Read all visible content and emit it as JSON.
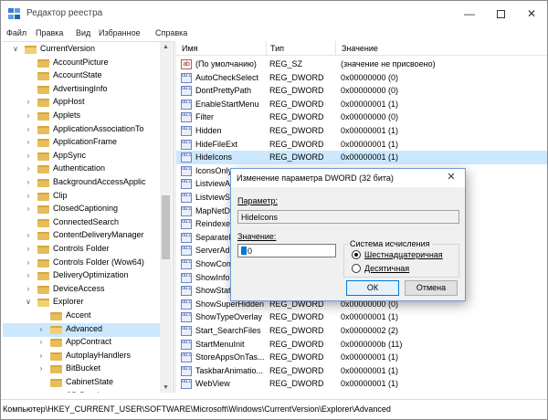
{
  "window": {
    "title": "Редактор реестра"
  },
  "menu": [
    "Файл",
    "Правка",
    "Вид",
    "Избранное",
    "Справка"
  ],
  "tree": [
    {
      "label": "CurrentVersion",
      "depth": 0,
      "chevron": "open",
      "open": true
    },
    {
      "label": "AccountPicture",
      "depth": 1,
      "chevron": "none"
    },
    {
      "label": "AccountState",
      "depth": 1,
      "chevron": "none"
    },
    {
      "label": "AdvertisingInfo",
      "depth": 1,
      "chevron": "none"
    },
    {
      "label": "AppHost",
      "depth": 1,
      "chevron": "closed"
    },
    {
      "label": "Applets",
      "depth": 1,
      "chevron": "closed"
    },
    {
      "label": "ApplicationAssociationTo",
      "depth": 1,
      "chevron": "closed"
    },
    {
      "label": "ApplicationFrame",
      "depth": 1,
      "chevron": "closed"
    },
    {
      "label": "AppSync",
      "depth": 1,
      "chevron": "closed"
    },
    {
      "label": "Authentication",
      "depth": 1,
      "chevron": "closed"
    },
    {
      "label": "BackgroundAccessApplic",
      "depth": 1,
      "chevron": "closed"
    },
    {
      "label": "Clip",
      "depth": 1,
      "chevron": "closed"
    },
    {
      "label": "ClosedCaptioning",
      "depth": 1,
      "chevron": "closed"
    },
    {
      "label": "ConnectedSearch",
      "depth": 1,
      "chevron": "none"
    },
    {
      "label": "ContentDeliveryManager",
      "depth": 1,
      "chevron": "closed"
    },
    {
      "label": "Controls Folder",
      "depth": 1,
      "chevron": "closed"
    },
    {
      "label": "Controls Folder (Wow64)",
      "depth": 1,
      "chevron": "closed"
    },
    {
      "label": "DeliveryOptimization",
      "depth": 1,
      "chevron": "closed"
    },
    {
      "label": "DeviceAccess",
      "depth": 1,
      "chevron": "closed"
    },
    {
      "label": "Explorer",
      "depth": 1,
      "chevron": "open",
      "open": true
    },
    {
      "label": "Accent",
      "depth": 2,
      "chevron": "none"
    },
    {
      "label": "Advanced",
      "depth": 2,
      "chevron": "closed",
      "selected": true
    },
    {
      "label": "AppContract",
      "depth": 2,
      "chevron": "closed"
    },
    {
      "label": "AutoplayHandlers",
      "depth": 2,
      "chevron": "closed"
    },
    {
      "label": "BitBucket",
      "depth": 2,
      "chevron": "closed"
    },
    {
      "label": "CabinetState",
      "depth": 2,
      "chevron": "none"
    },
    {
      "label": "CD Burning",
      "depth": 2,
      "chevron": "closed"
    }
  ],
  "columns": {
    "name": "Имя",
    "type": "Тип",
    "data": "Значение"
  },
  "values": [
    {
      "icon": "ab",
      "name": "(По умолчанию)",
      "type": "REG_SZ",
      "data": "(значение не присвоено)"
    },
    {
      "icon": "dw",
      "name": "AutoCheckSelect",
      "type": "REG_DWORD",
      "data": "0x00000000 (0)"
    },
    {
      "icon": "dw",
      "name": "DontPrettyPath",
      "type": "REG_DWORD",
      "data": "0x00000000 (0)"
    },
    {
      "icon": "dw",
      "name": "EnableStartMenu",
      "type": "REG_DWORD",
      "data": "0x00000001 (1)"
    },
    {
      "icon": "dw",
      "name": "Filter",
      "type": "REG_DWORD",
      "data": "0x00000000 (0)"
    },
    {
      "icon": "dw",
      "name": "Hidden",
      "type": "REG_DWORD",
      "data": "0x00000001 (1)"
    },
    {
      "icon": "dw",
      "name": "HideFileExt",
      "type": "REG_DWORD",
      "data": "0x00000001 (1)"
    },
    {
      "icon": "dw",
      "name": "HideIcons",
      "type": "REG_DWORD",
      "data": "0x00000001 (1)",
      "selected": true
    },
    {
      "icon": "dw",
      "name": "IconsOnly",
      "type": "",
      "data": ""
    },
    {
      "icon": "dw",
      "name": "ListviewAl",
      "type": "",
      "data": ""
    },
    {
      "icon": "dw",
      "name": "ListviewSh",
      "type": "",
      "data": ""
    },
    {
      "icon": "dw",
      "name": "MapNetDr",
      "type": "",
      "data": ""
    },
    {
      "icon": "dw",
      "name": "Reindexed",
      "type": "",
      "data": ""
    },
    {
      "icon": "dw",
      "name": "SeparatePr",
      "type": "",
      "data": ""
    },
    {
      "icon": "dw",
      "name": "ServerAdm",
      "type": "",
      "data": ""
    },
    {
      "icon": "dw",
      "name": "ShowCom",
      "type": "",
      "data": ""
    },
    {
      "icon": "dw",
      "name": "ShowInfoT",
      "type": "",
      "data": ""
    },
    {
      "icon": "dw",
      "name": "ShowStatu",
      "type": "",
      "data": ""
    },
    {
      "icon": "dw",
      "name": "ShowSuperHidden",
      "type": "REG_DWORD",
      "data": "0x00000000 (0)"
    },
    {
      "icon": "dw",
      "name": "ShowTypeOverlay",
      "type": "REG_DWORD",
      "data": "0x00000001 (1)"
    },
    {
      "icon": "dw",
      "name": "Start_SearchFiles",
      "type": "REG_DWORD",
      "data": "0x00000002 (2)"
    },
    {
      "icon": "dw",
      "name": "StartMenuInit",
      "type": "REG_DWORD",
      "data": "0x0000000b (11)"
    },
    {
      "icon": "dw",
      "name": "StoreAppsOnTas...",
      "type": "REG_DWORD",
      "data": "0x00000001 (1)"
    },
    {
      "icon": "dw",
      "name": "TaskbarAnimatio...",
      "type": "REG_DWORD",
      "data": "0x00000001 (1)"
    },
    {
      "icon": "dw",
      "name": "WebView",
      "type": "REG_DWORD",
      "data": "0x00000001 (1)"
    }
  ],
  "status": "Компьютер\\HKEY_CURRENT_USER\\SOFTWARE\\Microsoft\\Windows\\CurrentVersion\\Explorer\\Advanced",
  "dialog": {
    "title": "Изменение параметра DWORD (32 бита)",
    "param_label": "Параметр:",
    "param_value": "HideIcons",
    "value_label": "Значение:",
    "value_value": "0",
    "base_label": "Система исчисления",
    "hex_label": "Шестнадцатеричная",
    "dec_label": "Десятичная",
    "base_selected": "hex",
    "ok_label": "ОК",
    "cancel_label": "Отмена"
  }
}
